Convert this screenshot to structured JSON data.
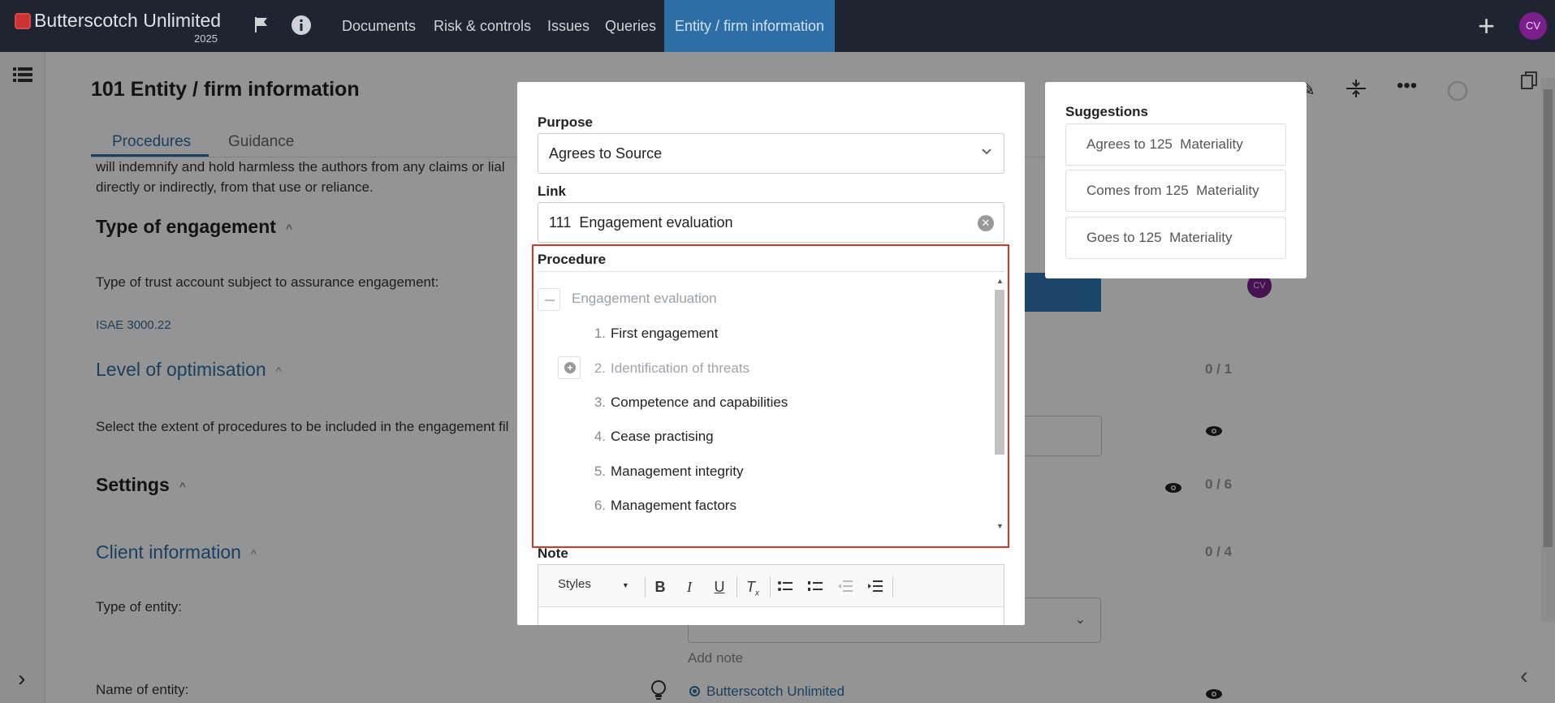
{
  "app": {
    "brand_name": "Butterscotch Unlimited",
    "brand_year": "2025",
    "avatar_initials": "CV",
    "nav": [
      {
        "label": "Documents"
      },
      {
        "label": "Risk & controls"
      },
      {
        "label": "Issues"
      },
      {
        "label": "Queries"
      },
      {
        "label": "Entity / firm information",
        "active": true
      }
    ]
  },
  "page": {
    "title": "101 Entity / firm information",
    "tabs": [
      {
        "label": "Procedures",
        "active": true
      },
      {
        "label": "Guidance"
      }
    ],
    "intro_line1": "will indemnify and hold harmless the authors from any claims or lial",
    "intro_line2": "directly or indirectly, from that use or reliance.",
    "type_engagement": {
      "heading": "Type of engagement",
      "question": "Type of trust account subject to assurance engagement:",
      "reference": "ISAE 3000.22",
      "assignee_initials": "CV"
    },
    "level_optimisation": {
      "heading": "Level of optimisation",
      "count": "0 / 1",
      "question": "Select the extent of procedures to be included in the engagement fil"
    },
    "settings": {
      "heading": "Settings",
      "count": "0 / 6"
    },
    "client_information": {
      "heading": "Client information",
      "count": "0 / 4",
      "type_of_entity_label": "Type of entity:",
      "add_note": "Add note",
      "name_of_entity_label": "Name of entity:",
      "name_of_entity_value": "Butterscotch Unlimited"
    }
  },
  "modal": {
    "purpose_label": "Purpose",
    "purpose_value": "Agrees to Source",
    "link_label": "Link",
    "link_value": "111  Engagement evaluation",
    "procedure_label": "Procedure",
    "procedure_parent": "Engagement evaluation",
    "procedures": [
      {
        "num": "1.",
        "label": "First engagement",
        "dim": false
      },
      {
        "num": "2.",
        "label": "Identification of threats",
        "dim": true
      },
      {
        "num": "3.",
        "label": "Competence and capabilities",
        "dim": false
      },
      {
        "num": "4.",
        "label": "Cease practising",
        "dim": false
      },
      {
        "num": "5.",
        "label": "Management integrity",
        "dim": false
      },
      {
        "num": "6.",
        "label": "Management factors",
        "dim": false
      }
    ],
    "note_label": "Note",
    "editor": {
      "styles_label": "Styles"
    }
  },
  "suggestions": {
    "title": "Suggestions",
    "items": [
      {
        "label": "Agrees to 125  Materiality"
      },
      {
        "label": "Comes from 125  Materiality"
      },
      {
        "label": "Goes to 125  Materiality"
      }
    ]
  },
  "colors": {
    "topbar": "#1e2530",
    "accent": "#2e6ea7",
    "highlight_border": "#d9342b",
    "avatar": "#7b1f8c"
  }
}
